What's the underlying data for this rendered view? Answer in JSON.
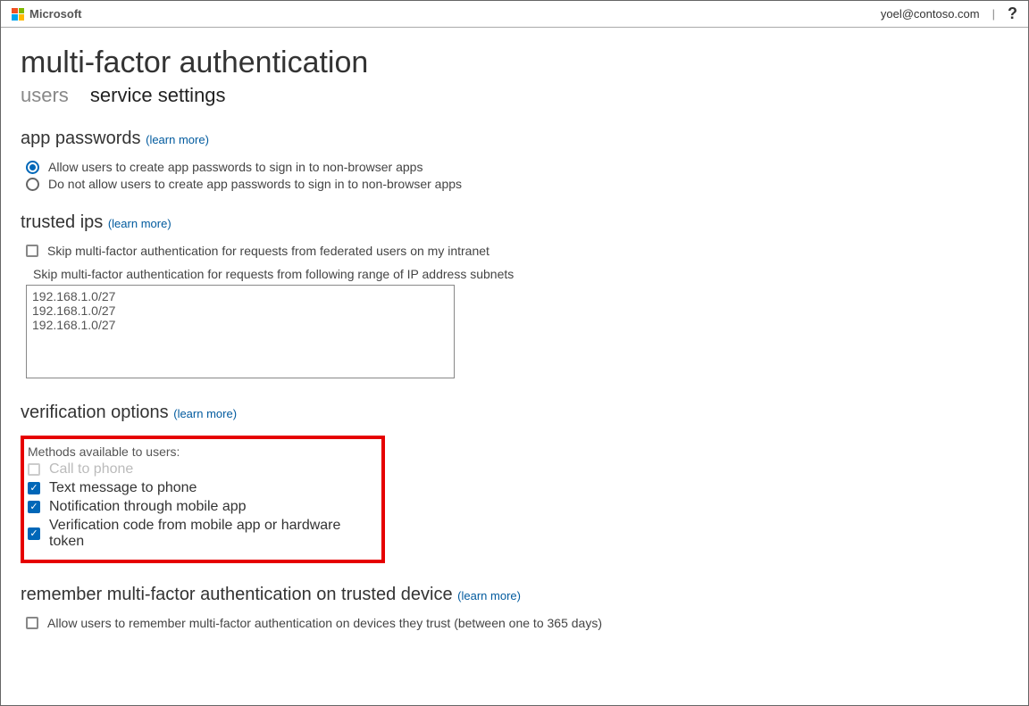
{
  "header": {
    "brand": "Microsoft",
    "user_email": "yoel@contoso.com",
    "separator": "|",
    "help": "?"
  },
  "page": {
    "title": "multi-factor authentication"
  },
  "tabs": {
    "users": "users",
    "service_settings": "service settings"
  },
  "app_passwords": {
    "title": "app passwords",
    "learn_more": "learn more",
    "opt_allow": "Allow users to create app passwords to sign in to non-browser apps",
    "opt_disallow": "Do not allow users to create app passwords to sign in to non-browser apps"
  },
  "trusted_ips": {
    "title": "trusted ips",
    "learn_more": "learn more",
    "skip_federated": "Skip multi-factor authentication for requests from federated users on my intranet",
    "skip_ranges_label": "Skip multi-factor authentication for requests from following range of IP address subnets",
    "ip_list": "192.168.1.0/27\n192.168.1.0/27\n192.168.1.0/27"
  },
  "verification": {
    "title": "verification options",
    "learn_more": "learn more",
    "methods_label": "Methods available to users:",
    "m1": "Call to phone",
    "m2": "Text message to phone",
    "m3": "Notification through mobile app",
    "m4": "Verification code from mobile app or hardware token"
  },
  "remember": {
    "title": "remember multi-factor authentication on trusted device",
    "learn_more": "learn more",
    "opt": "Allow users to remember multi-factor authentication on devices they trust (between one to 365 days)"
  }
}
